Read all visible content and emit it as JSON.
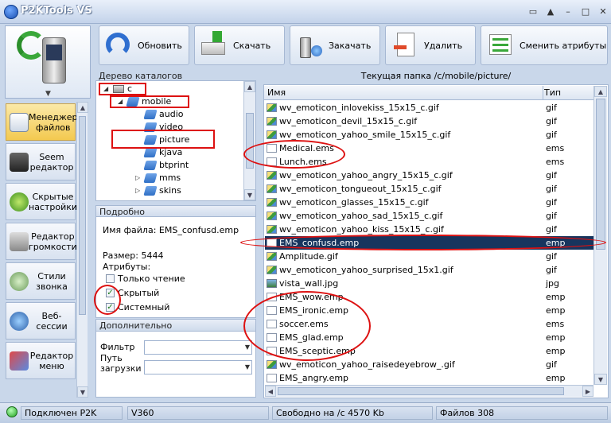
{
  "window": {
    "title": "P2KTools VS",
    "controls": [
      "▭",
      "▲",
      "–",
      "□",
      "✕"
    ]
  },
  "colors": {
    "accent_blue": "#17355e",
    "annotation_red": "#dd1111",
    "active_nav": "#f3c94f",
    "panel_bg": "#c9d7ea"
  },
  "nav": {
    "items": [
      {
        "label": "Менеджер файлов",
        "icon": "file-manager-icon",
        "active": true
      },
      {
        "label": "Seem редактор",
        "icon": "seem-editor-icon",
        "active": false
      },
      {
        "label": "Скрытые настройки",
        "icon": "hidden-settings-icon",
        "active": false
      },
      {
        "label": "Редактор громкости",
        "icon": "volume-editor-icon",
        "active": false
      },
      {
        "label": "Стили звонка",
        "icon": "ring-styles-icon",
        "active": false
      },
      {
        "label": "Веб-сессии",
        "icon": "web-sessions-icon",
        "active": false
      },
      {
        "label": "Редактор меню",
        "icon": "menu-editor-icon",
        "active": false
      }
    ]
  },
  "toolbar": {
    "refresh": "Обновить",
    "download": "Скачать",
    "upload": "Закачать",
    "delete": "Удалить",
    "change_attrs": "Сменить атрибуты"
  },
  "tree": {
    "title": "Дерево каталогов",
    "items": [
      {
        "label": "c",
        "expander": "◢"
      },
      {
        "label": "mobile",
        "expander": "◢"
      },
      {
        "label": "audio",
        "expander": ""
      },
      {
        "label": "video",
        "expander": ""
      },
      {
        "label": "picture",
        "expander": ""
      },
      {
        "label": "kjava",
        "expander": ""
      },
      {
        "label": "btprint",
        "expander": ""
      },
      {
        "label": "mms",
        "expander": "▷"
      },
      {
        "label": "skins",
        "expander": "▷"
      }
    ]
  },
  "details": {
    "title": "Подробно",
    "filename": "Имя файла: EMS_confusd.emp",
    "size": "Размер: 5444",
    "attributes_label": "Атрибуты:",
    "readonly": {
      "label": "Только чтение",
      "checked": false
    },
    "hidden": {
      "label": "Скрытый",
      "checked": true
    },
    "system": {
      "label": "Системный",
      "checked": true
    }
  },
  "extra": {
    "title": "Дополнительно",
    "filter_label": "Фильтр",
    "path_label_1": "Путь",
    "path_label_2": "загрузки",
    "filter_value": "",
    "path_value": ""
  },
  "filelist": {
    "current_folder": "Текущая папка /c/mobile/picture/",
    "col_name": "Имя",
    "col_type": "Тип",
    "rows": [
      {
        "name": "wv_emoticon_inlovekiss_15x15_c.gif",
        "type": "gif",
        "icon": "img",
        "selected": false
      },
      {
        "name": "wv_emoticon_devil_15x15_c.gif",
        "type": "gif",
        "icon": "img",
        "selected": false
      },
      {
        "name": "wv_emoticon_yahoo_smile_15x15_c.gif",
        "type": "gif",
        "icon": "img",
        "selected": false
      },
      {
        "name": "Medical.ems",
        "type": "ems",
        "icon": "doc",
        "selected": false
      },
      {
        "name": "Lunch.ems",
        "type": "ems",
        "icon": "doc",
        "selected": false
      },
      {
        "name": "wv_emoticon_yahoo_angry_15x15_c.gif",
        "type": "gif",
        "icon": "img",
        "selected": false
      },
      {
        "name": "wv_emoticon_tongueout_15x15_c.gif",
        "type": "gif",
        "icon": "img",
        "selected": false
      },
      {
        "name": "wv_emoticon_glasses_15x15_c.gif",
        "type": "gif",
        "icon": "img",
        "selected": false
      },
      {
        "name": "wv_emoticon_yahoo_sad_15x15_c.gif",
        "type": "gif",
        "icon": "img",
        "selected": false
      },
      {
        "name": "wv_emoticon_yahoo_kiss_15x15_c.gif",
        "type": "gif",
        "icon": "img",
        "selected": false
      },
      {
        "name": "EMS_confusd.emp",
        "type": "emp",
        "icon": "doc",
        "selected": true
      },
      {
        "name": "Amplitude.gif",
        "type": "gif",
        "icon": "img",
        "selected": false
      },
      {
        "name": "wv_emoticon_yahoo_surprised_15x1.gif",
        "type": "gif",
        "icon": "img",
        "selected": false
      },
      {
        "name": "vista_wall.jpg",
        "type": "jpg",
        "icon": "jpg",
        "selected": false
      },
      {
        "name": "EMS_wow.emp",
        "type": "emp",
        "icon": "doc",
        "selected": false
      },
      {
        "name": "EMS_ironic.emp",
        "type": "emp",
        "icon": "doc",
        "selected": false
      },
      {
        "name": "soccer.ems",
        "type": "ems",
        "icon": "doc",
        "selected": false
      },
      {
        "name": "EMS_glad.emp",
        "type": "emp",
        "icon": "doc",
        "selected": false
      },
      {
        "name": "EMS_sceptic.emp",
        "type": "emp",
        "icon": "doc",
        "selected": false
      },
      {
        "name": "wv_emoticon_yahoo_raisedeyebrow_.gif",
        "type": "gif",
        "icon": "img",
        "selected": false
      },
      {
        "name": "EMS_angry.emp",
        "type": "emp",
        "icon": "doc",
        "selected": false
      }
    ]
  },
  "status": {
    "connection": "Подключен P2K",
    "model": "V360",
    "free": "Свободно на /c 4570 Kb",
    "files": "Файлов 308"
  }
}
